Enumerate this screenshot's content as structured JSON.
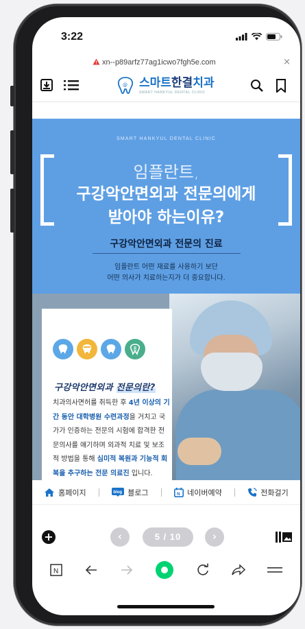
{
  "status": {
    "time": "3:22"
  },
  "url_bar": {
    "url": "xn--p89arfz77ag1icwo7fgh5e.com",
    "close_label": "×"
  },
  "header": {
    "logo_name_prefix": "스마트",
    "logo_name_highlight": "한결",
    "logo_name_suffix": "치과",
    "logo_sub": "SMART HANKYUL DENTAL CLINIC"
  },
  "banner": {
    "clinic_en": "SMART HANKYUL DENTAL CLINIC",
    "line1": "임플란트,",
    "line2": "구강악안면외과 전문의에게",
    "line3": "받아야 하는이유?",
    "subtitle": "구강악안면외과 전문의 진료",
    "desc1": "임플란트 어떤 재료를 사용하기 보단",
    "desc2": "어떤 의사가 치료하는지가 더 중요합니다."
  },
  "panel": {
    "title_a": "구강악안면외과 ",
    "title_b": "전문의란?",
    "p1": "치과의사면허를 취득한 후 ",
    "p1b": "4년 이상의 기간 동안 대학병원 수련과정",
    "p2": "을 거치고 국가가 인증하는 전문의 시험에 합격한 전문의사를 얘기하며 외과적 치료 및 보조적 방법을 통해 ",
    "p2b": "심미적 복원과 기능적 회복을 추구하는 전문 의료진",
    "p3": " 입니다."
  },
  "quick_links": [
    {
      "label": "홈페이지"
    },
    {
      "label": "블로그"
    },
    {
      "label": "네이버예약"
    },
    {
      "label": "전화걸기"
    }
  ],
  "pager": {
    "current": "5 / 10"
  },
  "colors": {
    "accent": "#1a73c8",
    "banner": "#5e9fe4",
    "reload_dot": "#00d372"
  }
}
